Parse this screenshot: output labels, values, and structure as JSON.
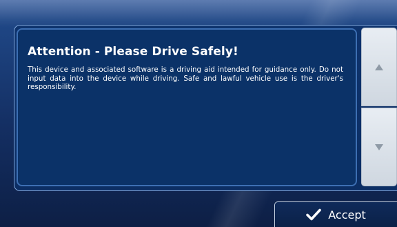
{
  "dialog": {
    "title": "Attention - Please Drive Safely!",
    "message": "This device and associated software is a driving aid intended for guidance only. Do not input data into the device while driving. Safe and lawful vehicle use is the driver's responsibility."
  },
  "scroll": {
    "up_icon": "triangle-up-icon",
    "down_icon": "triangle-down-icon"
  },
  "actions": {
    "accept_label": "Accept",
    "accept_icon": "check-icon"
  },
  "colors": {
    "panel_background": "#0b3268",
    "panel_border": "#3d6fb3",
    "scroll_button": "#dde3ea",
    "arrow": "#8f9aa6",
    "text": "#ffffff"
  }
}
